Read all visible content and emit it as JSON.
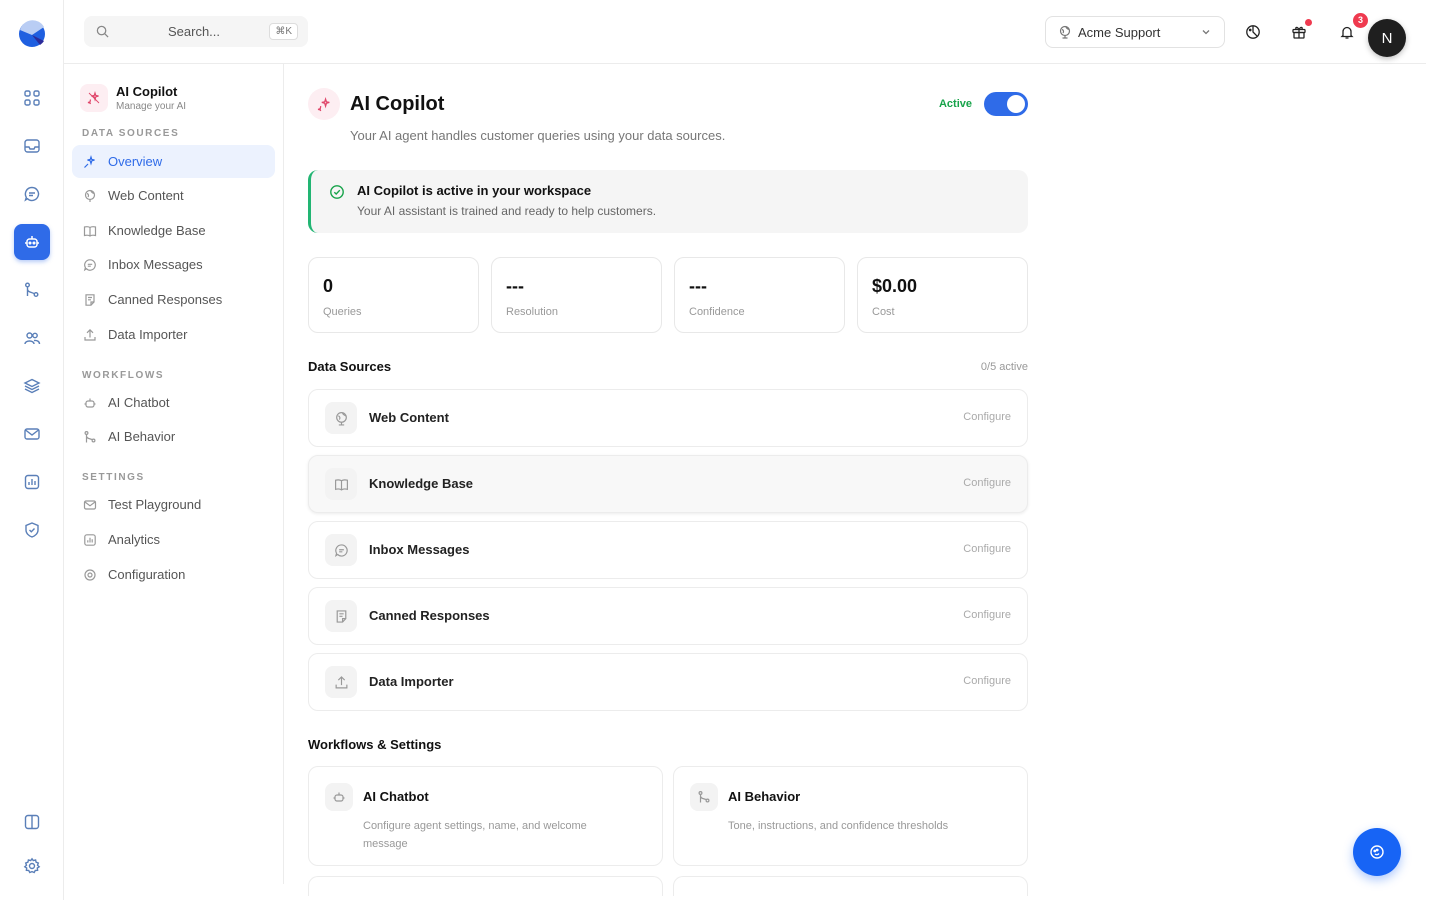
{
  "topbar": {
    "search_placeholder": "Search...",
    "search_shortcut": "⌘K",
    "workspace": "Acme Support",
    "notifications_count": "3",
    "avatar_initial": "N"
  },
  "subnav": {
    "title": "AI Copilot",
    "subtitle": "Manage your AI",
    "sections": {
      "data_sources": "DATA SOURCES",
      "workflows": "WORKFLOWS",
      "settings": "SETTINGS"
    },
    "items": [
      {
        "label": "Overview",
        "icon": "sparkles-icon"
      },
      {
        "label": "Web Content",
        "icon": "globe-icon"
      },
      {
        "label": "Knowledge Base",
        "icon": "book-icon"
      },
      {
        "label": "Inbox Messages",
        "icon": "chat-icon"
      },
      {
        "label": "Canned Responses",
        "icon": "note-icon"
      },
      {
        "label": "Data Importer",
        "icon": "upload-icon"
      },
      {
        "label": "AI Chatbot",
        "icon": "bot-icon"
      },
      {
        "label": "AI Behavior",
        "icon": "branch-icon"
      },
      {
        "label": "Test Playground",
        "icon": "mail-icon"
      },
      {
        "label": "Analytics",
        "icon": "chart-icon"
      },
      {
        "label": "Configuration",
        "icon": "gear-icon"
      }
    ]
  },
  "main": {
    "title": "AI Copilot",
    "subtitle": "Your AI agent handles customer queries using your data sources.",
    "toggle_label": "Active",
    "banner": {
      "title": "AI Copilot is active in your workspace",
      "text": "Your AI assistant is trained and ready to help customers."
    },
    "stats": [
      {
        "value": "0",
        "label": "Queries"
      },
      {
        "value": "---",
        "label": "Resolution"
      },
      {
        "value": "---",
        "label": "Confidence"
      },
      {
        "value": "$0.00",
        "label": "Cost"
      }
    ],
    "data_sources_title": "Data Sources",
    "data_sources_meta": "0/5 active",
    "sources": [
      {
        "name": "Web Content",
        "action": "Configure"
      },
      {
        "name": "Knowledge Base",
        "action": "Configure"
      },
      {
        "name": "Inbox Messages",
        "action": "Configure"
      },
      {
        "name": "Canned Responses",
        "action": "Configure"
      },
      {
        "name": "Data Importer",
        "action": "Configure"
      }
    ],
    "workflows_title": "Workflows & Settings",
    "workflows": [
      {
        "name": "AI Chatbot",
        "desc": "Configure agent settings, name, and welcome message"
      },
      {
        "name": "AI Behavior",
        "desc": "Tone, instructions, and confidence thresholds"
      }
    ]
  },
  "colors": {
    "accent": "#2f6be8",
    "success": "#17a34a",
    "danger": "#ef3a4f",
    "brand_pink": "#e0466a"
  }
}
